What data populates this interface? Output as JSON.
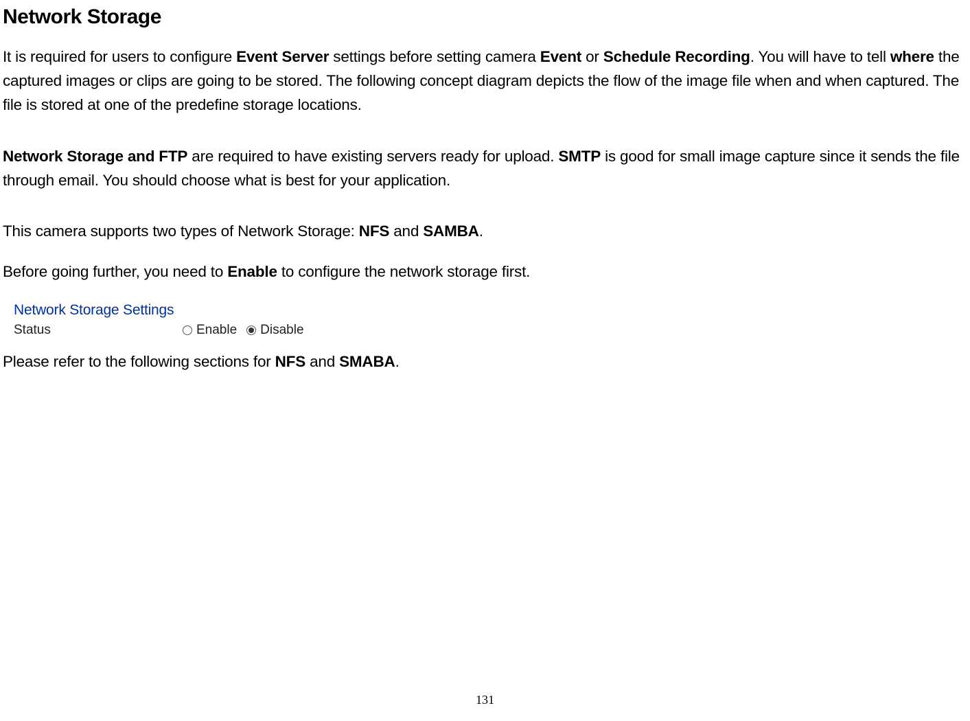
{
  "page": {
    "title": "Network Storage",
    "number": "131"
  },
  "paragraphs": {
    "p1_part1": "It is required for users to configure ",
    "p1_b1": "Event Server",
    "p1_part2": " settings before setting camera ",
    "p1_b2": "Event",
    "p1_part3": " or ",
    "p1_b3": "Schedule Recording",
    "p1_part4": ". You will have to tell ",
    "p1_b4": "where",
    "p1_part5": " the captured images or clips are going to be stored. The following concept diagram depicts the flow of the image file when and when captured. The file is stored at one of the predefine storage locations.",
    "p2_b1": "Network Storage and FTP",
    "p2_part1": " are required to have existing servers ready for upload. ",
    "p2_b2": "SMTP",
    "p2_part2": " is good for small image capture since it sends the file through email. You should choose what is best for your application.",
    "p3_part1": "This camera supports two types of Network Storage: ",
    "p3_b1": "NFS",
    "p3_part2": " and ",
    "p3_b2": "SAMBA",
    "p3_part3": ".",
    "p4_part1": "Before going further, you need to ",
    "p4_b1": "Enable",
    "p4_part2": " to configure the network storage first.",
    "p5_part1": "Please refer to the following sections for ",
    "p5_b1": "NFS",
    "p5_part2": " and ",
    "p5_b2": "SMABA",
    "p5_part3": "."
  },
  "panel": {
    "heading": "Network Storage Settings",
    "status_label": "Status",
    "enable_label": "Enable",
    "disable_label": "Disable"
  }
}
